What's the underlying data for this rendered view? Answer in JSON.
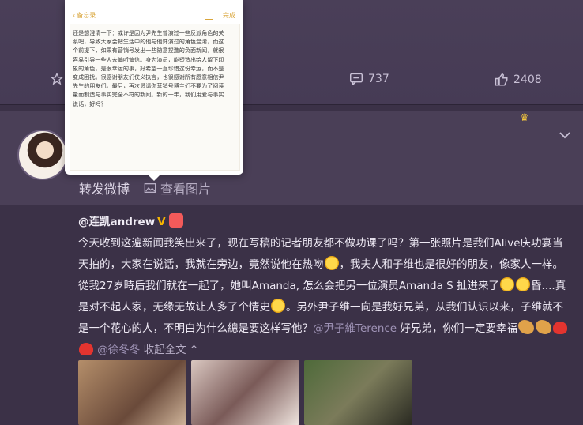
{
  "actions": {
    "comments": "737",
    "likes": "2408"
  },
  "sub_actions": {
    "repost_label": "转发微博",
    "view_image_label": "查看图片"
  },
  "note": {
    "back_label": "备忘录",
    "done_label": "完成",
    "body": "还是想澄清一下：或许是因为尹先生曾演过一些反派角色的关系吧，导致大家会把生活中的他与他饰演过的角色混淆，而这个前提下，如果有营销号发出一些随意捏造的负面新闻，就很容易引导一些人去偏听偏信。身为演员，能塑造出给人留下印象的角色，是很幸运的事，好希望一直珍惜这份幸运，而不是变成困扰。很感谢朋友们仗义执言，也很感谢所有愿意相信尹先生的朋友们。最后，再次恳请你营销号博主们不要为了阅读量而制造与事实完全不符的新闻。新的一年，我们用爱与事实说话，好吗？"
  },
  "post": {
    "username": "@连凯andrew",
    "text1": "今天收到这遍新闻我笑出来了，现在写稿的记者朋友都不做功课了吗？第一张照片是我们Alive庆功宴当天拍的，大家在说话，我就在旁边，竟然说他在热吻",
    "text2": "，我夫人和子维也是很好的朋友，像家人一样。 從我27岁時后我们就在一起了，她叫Amanda, 怎么会把另一位演员Amanda S 扯进来了",
    "text3": "昏....真是对不起人家，无缘无故让人多了个情史",
    "text4": "。另外尹子维一向是我好兄弟，从我们认识以来，子维就不是一个花心的人，不明白为什么總是要这样写他？",
    "mention1": "@尹子維Terence",
    "text5": " 好兄弟，你们一定要幸福",
    "mention2": "@徐冬冬",
    "collapse_label": "收起全文"
  },
  "colors": {
    "background": "#3b3147",
    "card": "#4a3f57",
    "link": "#9f93b6",
    "crown": "#f2c53d"
  },
  "icons": [
    "star-icon",
    "comment-icon",
    "like-icon",
    "crown-icon",
    "chevron-down-icon",
    "image-icon",
    "vip-badge-icon",
    "medal-icon",
    "laugh-emoji",
    "arm-emoji",
    "heart-emoji"
  ]
}
